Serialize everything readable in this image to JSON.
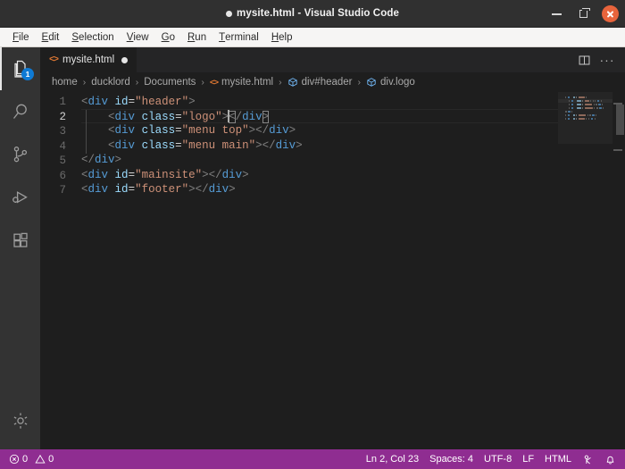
{
  "window": {
    "title": "mysite.html - Visual Studio Code",
    "dirty_indicator": "●",
    "controls": {
      "minimize_label": "Minimize",
      "maximize_label": "Maximize",
      "close_label": "Close"
    }
  },
  "menubar": {
    "items": [
      {
        "mnemonic": "F",
        "rest": "ile"
      },
      {
        "mnemonic": "E",
        "rest": "dit"
      },
      {
        "mnemonic": "S",
        "rest": "election"
      },
      {
        "mnemonic": "V",
        "rest": "iew"
      },
      {
        "mnemonic": "G",
        "rest": "o"
      },
      {
        "mnemonic": "R",
        "rest": "un"
      },
      {
        "mnemonic": "T",
        "rest": "erminal"
      },
      {
        "mnemonic": "H",
        "rest": "elp"
      }
    ]
  },
  "activitybar": {
    "items": [
      {
        "name": "explorer",
        "label": "Explorer",
        "icon": "files-icon",
        "badge": "1",
        "active": true
      },
      {
        "name": "search",
        "label": "Search",
        "icon": "search-icon",
        "badge": "",
        "active": false
      },
      {
        "name": "source-control",
        "label": "Source Control",
        "icon": "source-control-icon",
        "badge": "",
        "active": false
      },
      {
        "name": "run-debug",
        "label": "Run and Debug",
        "icon": "run-debug-icon",
        "badge": "",
        "active": false
      },
      {
        "name": "extensions",
        "label": "Extensions",
        "icon": "extensions-icon",
        "badge": "",
        "active": false
      }
    ],
    "bottom": [
      {
        "name": "manage",
        "label": "Manage",
        "icon": "gear-icon"
      }
    ]
  },
  "tabs": {
    "items": [
      {
        "label": "mysite.html",
        "icon": "html-file-icon",
        "dirty": true,
        "active": true
      }
    ],
    "actions": [
      {
        "name": "split-editor",
        "label": "Split Editor",
        "icon": "split-editor-icon"
      },
      {
        "name": "more-actions",
        "label": "More Actions...",
        "icon": "ellipsis-icon",
        "glyph": "···"
      }
    ]
  },
  "breadcrumbs": {
    "separator": "›",
    "segments": [
      {
        "label": "home",
        "icon": ""
      },
      {
        "label": "ducklord",
        "icon": ""
      },
      {
        "label": "Documents",
        "icon": ""
      },
      {
        "label": "mysite.html",
        "icon": "html-file-icon"
      },
      {
        "label": "div#header",
        "icon": "symbol-field-icon"
      },
      {
        "label": "div.logo",
        "icon": "symbol-field-icon"
      }
    ]
  },
  "editor": {
    "language": "HTML",
    "line_numbers": [
      "1",
      "2",
      "3",
      "4",
      "5",
      "6",
      "7"
    ],
    "current_line": 2,
    "cursor": {
      "line": 2,
      "column": 23
    },
    "lines": [
      {
        "number": "1",
        "indent": 0,
        "tokens": [
          {
            "t": "punct",
            "v": "<"
          },
          {
            "t": "tag",
            "v": "div"
          },
          {
            "t": "text",
            "v": " "
          },
          {
            "t": "attr",
            "v": "id"
          },
          {
            "t": "eq",
            "v": "="
          },
          {
            "t": "str",
            "v": "\"header\""
          },
          {
            "t": "punct",
            "v": ">"
          }
        ]
      },
      {
        "number": "2",
        "indent": 4,
        "tokens": [
          {
            "t": "punct",
            "v": "<"
          },
          {
            "t": "tag",
            "v": "div"
          },
          {
            "t": "text",
            "v": " "
          },
          {
            "t": "attr",
            "v": "class"
          },
          {
            "t": "eq",
            "v": "="
          },
          {
            "t": "str",
            "v": "\"logo\""
          },
          {
            "t": "punct",
            "v": ">"
          },
          {
            "t": "caret",
            "v": ""
          },
          {
            "t": "punct-box",
            "v": "<"
          },
          {
            "t": "punct",
            "v": "/"
          },
          {
            "t": "tag",
            "v": "div"
          },
          {
            "t": "punct-box",
            "v": ">"
          }
        ]
      },
      {
        "number": "3",
        "indent": 4,
        "tokens": [
          {
            "t": "punct",
            "v": "<"
          },
          {
            "t": "tag",
            "v": "div"
          },
          {
            "t": "text",
            "v": " "
          },
          {
            "t": "attr",
            "v": "class"
          },
          {
            "t": "eq",
            "v": "="
          },
          {
            "t": "str",
            "v": "\"menu top\""
          },
          {
            "t": "punct",
            "v": ">"
          },
          {
            "t": "punct",
            "v": "</"
          },
          {
            "t": "tag",
            "v": "div"
          },
          {
            "t": "punct",
            "v": ">"
          }
        ]
      },
      {
        "number": "4",
        "indent": 4,
        "tokens": [
          {
            "t": "punct",
            "v": "<"
          },
          {
            "t": "tag",
            "v": "div"
          },
          {
            "t": "text",
            "v": " "
          },
          {
            "t": "attr",
            "v": "class"
          },
          {
            "t": "eq",
            "v": "="
          },
          {
            "t": "str",
            "v": "\"menu main\""
          },
          {
            "t": "punct",
            "v": ">"
          },
          {
            "t": "punct",
            "v": "</"
          },
          {
            "t": "tag",
            "v": "div"
          },
          {
            "t": "punct",
            "v": ">"
          }
        ]
      },
      {
        "number": "5",
        "indent": 0,
        "tokens": [
          {
            "t": "punct",
            "v": "</"
          },
          {
            "t": "tag",
            "v": "div"
          },
          {
            "t": "punct",
            "v": ">"
          }
        ]
      },
      {
        "number": "6",
        "indent": 0,
        "tokens": [
          {
            "t": "punct",
            "v": "<"
          },
          {
            "t": "tag",
            "v": "div"
          },
          {
            "t": "text",
            "v": " "
          },
          {
            "t": "attr",
            "v": "id"
          },
          {
            "t": "eq",
            "v": "="
          },
          {
            "t": "str",
            "v": "\"mainsite\""
          },
          {
            "t": "punct",
            "v": ">"
          },
          {
            "t": "punct",
            "v": "</"
          },
          {
            "t": "tag",
            "v": "div"
          },
          {
            "t": "punct",
            "v": ">"
          }
        ]
      },
      {
        "number": "7",
        "indent": 0,
        "tokens": [
          {
            "t": "punct",
            "v": "<"
          },
          {
            "t": "tag",
            "v": "div"
          },
          {
            "t": "text",
            "v": " "
          },
          {
            "t": "attr",
            "v": "id"
          },
          {
            "t": "eq",
            "v": "="
          },
          {
            "t": "str",
            "v": "\"footer\""
          },
          {
            "t": "punct",
            "v": ">"
          },
          {
            "t": "punct",
            "v": "</"
          },
          {
            "t": "tag",
            "v": "div"
          },
          {
            "t": "punct",
            "v": ">"
          }
        ]
      }
    ],
    "source_text": "<div id=\"header\">\n    <div class=\"logo\"></div>\n    <div class=\"menu top\"></div>\n    <div class=\"menu main\"></div>\n</div>\n<div id=\"mainsite\"></div>\n<div id=\"footer\"></div>"
  },
  "statusbar": {
    "errors": "0",
    "warnings": "0",
    "position": "Ln 2, Col 23",
    "indentation": "Spaces: 4",
    "encoding": "UTF-8",
    "eol": "LF",
    "language_mode": "HTML",
    "feedback_icon": "feedback-icon",
    "notifications_icon": "bell-icon"
  },
  "colors": {
    "titlebar_bg": "#303030",
    "menubar_bg": "#f6f5f4",
    "activitybar_bg": "#333333",
    "editor_bg": "#1e1e1e",
    "tabsbar_bg": "#252526",
    "statusbar_bg": "#8f2d91",
    "badge_bg": "#0e7ad4",
    "close_btn_bg": "#e8643c",
    "token_tag": "#569cd6",
    "token_attr": "#9cdcfe",
    "token_string": "#ce9178",
    "token_punct": "#808080",
    "html_icon": "#e37933"
  }
}
